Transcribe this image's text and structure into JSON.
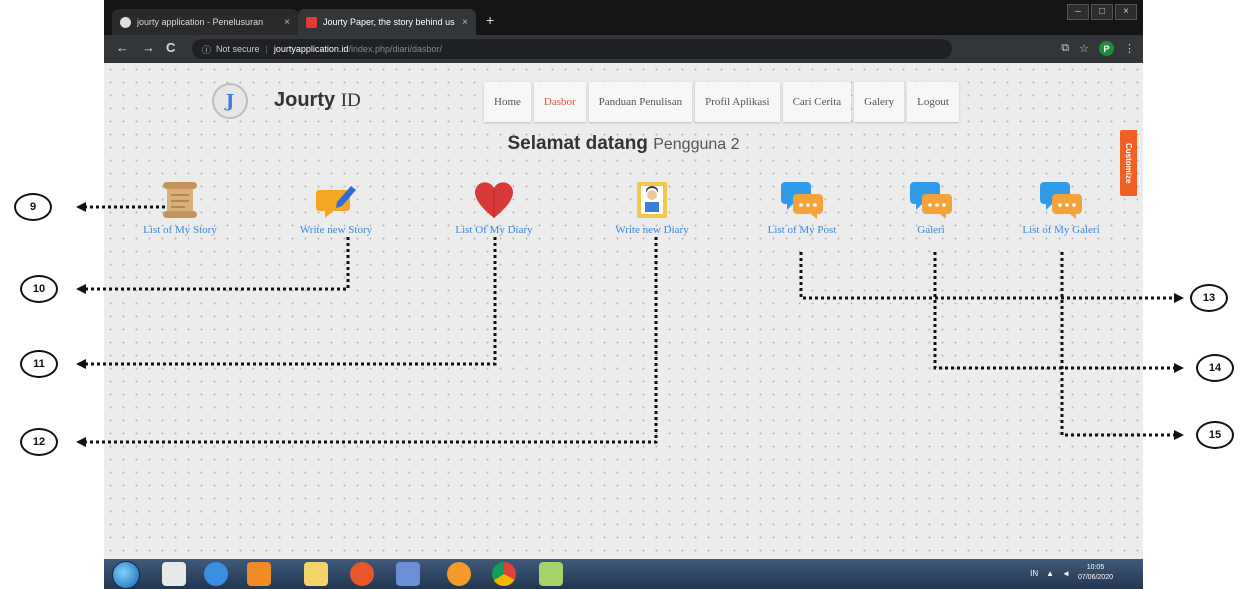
{
  "browser": {
    "tabs": [
      {
        "title": "jourty application - Penelusuran",
        "close": "×",
        "favicon_color": "#dddddd"
      },
      {
        "title": "Jourty Paper, the story behind us",
        "close": "×",
        "favicon_color": "#e53935"
      }
    ],
    "new_tab": "+",
    "window_controls": [
      "–",
      "□",
      "×"
    ],
    "nav": {
      "back": "←",
      "forward": "→",
      "reload": "C"
    },
    "address": {
      "security": "Not secure",
      "host": "jourtyapplication.id",
      "path": "/index.php/diari/dasbor/"
    },
    "toolbar_icons": [
      "translate-icon",
      "star-icon"
    ],
    "profile_initial": "P"
  },
  "site": {
    "logo_letter": "J",
    "brand": "Jourty",
    "brand_suffix": "ID",
    "nav": [
      "Home",
      "Dasbor",
      "Panduan Penulisan",
      "Profil Aplikasi",
      "Cari Cerita",
      "Galery",
      "Logout"
    ],
    "active_nav": "Dasbor",
    "welcome": "Selamat datang",
    "user": "Pengguna 2",
    "customize": "Customize"
  },
  "features": [
    {
      "label": "List of My Story",
      "icon": "scroll-icon"
    },
    {
      "label": "Write new Story",
      "icon": "write-icon"
    },
    {
      "label": "List Of My Diary",
      "icon": "heart-icon"
    },
    {
      "label": "Write new Diary",
      "icon": "diary-icon"
    },
    {
      "label": "List of My Post",
      "icon": "chat-icon"
    },
    {
      "label": "Galeri",
      "icon": "chat-icon"
    },
    {
      "label": "List of My Galeri",
      "icon": "chat-icon"
    }
  ],
  "annotations": [
    "9",
    "10",
    "11",
    "12",
    "13",
    "14",
    "15"
  ],
  "taskbar": {
    "apps": [
      "calendar-icon",
      "ie-icon",
      "media-icon",
      "folder-icon",
      "firefox-icon",
      "word-icon",
      "app-icon",
      "chrome-icon",
      "app-icon"
    ],
    "lang": "IN",
    "time": "10:05",
    "date": "07/06/2020"
  },
  "colors": {
    "accent_link": "#3b86d8",
    "nav_active": "#d9534f",
    "customize": "#f06022"
  }
}
